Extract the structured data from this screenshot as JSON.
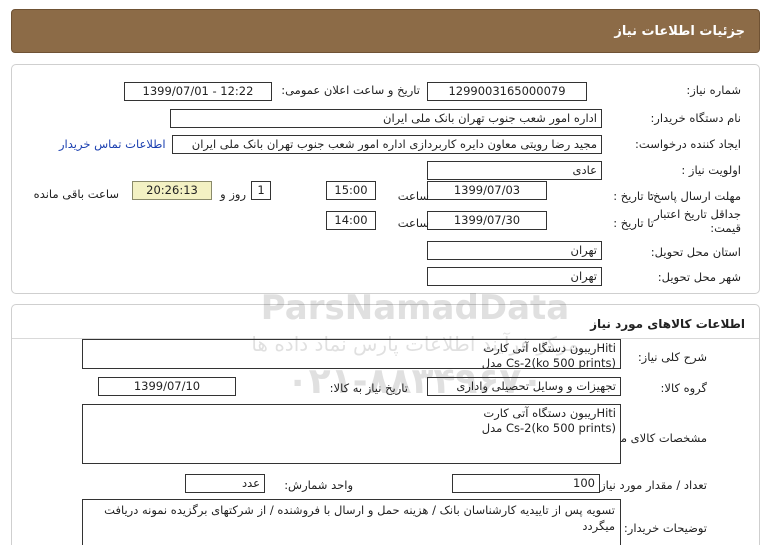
{
  "header": {
    "title": "جزئیات اطلاعات نیاز"
  },
  "general": {
    "need_number_label": "شماره نیاز:",
    "need_number": "1299003165000079",
    "announce_label": "تاریخ و ساعت اعلان عمومی:",
    "announce_value": "1399/07/01 - 12:22",
    "buyer_label": "نام دستگاه خریدار:",
    "buyer_value": "اداره امور شعب جنوب تهران بانک ملی ایران",
    "creator_label": "ایجاد کننده درخواست:",
    "creator_value": "مجید رضا رویتی معاون دایره کاربردازی اداره امور شعب جنوب تهران بانک ملی ایران",
    "contact_link": "اطلاعات تماس خریدار",
    "priority_label": "اولویت نیاز :",
    "priority_value": "عادی",
    "deadline_label": "مهلت ارسال پاسخ:",
    "to_date_label": "تا تاریخ :",
    "deadline_date": "1399/07/03",
    "time_label": "ساعت",
    "deadline_time": "15:00",
    "days_value": "1",
    "days_label": "روز و",
    "remaining_time": "20:26:13",
    "remaining_label": "ساعت باقی مانده",
    "validity_label_1": "جداقل تاریخ اعتبار",
    "validity_label_2": "قیمت:",
    "validity_date": "1399/07/30",
    "validity_time": "14:00",
    "province_label": "استان محل تحویل:",
    "province_value": "تهران",
    "city_label": "شهر محل تحویل:",
    "city_value": "تهران"
  },
  "goods": {
    "section_title": "اطلاعات کالاهای مورد نیاز",
    "summary_label": "شرح کلی نیاز:",
    "summary_line1": "ریبون دستگاه آتی کارتHiti",
    "summary_line2": "مدل Cs-2(ko 500 prints)",
    "group_label": "گروه کالا:",
    "group_value": "تجهیزات و وسایل تحصیلی واداری",
    "need_date_label": "تاریخ نیاز به کالا:",
    "need_date_value": "1399/07/10",
    "spec_label": "مشخصات کالای مورد نیاز:",
    "spec_line1": "ریبون دستگاه آتی کارتHiti",
    "spec_line2": "مدل Cs-2(ko 500 prints)",
    "qty_label": "تعداد / مقدار مورد نیاز:",
    "qty_value": "100",
    "unit_label": "واحد شمارش:",
    "unit_value": "عدد",
    "desc_label": "توضیحات خریدار:",
    "desc_value": "تسویه پس از تاییدیه کارشناسان بانک / هزینه حمل و ارسال با فروشنده / از شرکتهای برگزیده نمونه دریافت میگردد"
  },
  "watermark": {
    "brand": "ParsNamadData",
    "subtitle": "مرکز فرآیند اطلاعات پارس نماد داده ها",
    "phone": "۰۲۱-۸۸۳۴۹۶۷۰"
  }
}
